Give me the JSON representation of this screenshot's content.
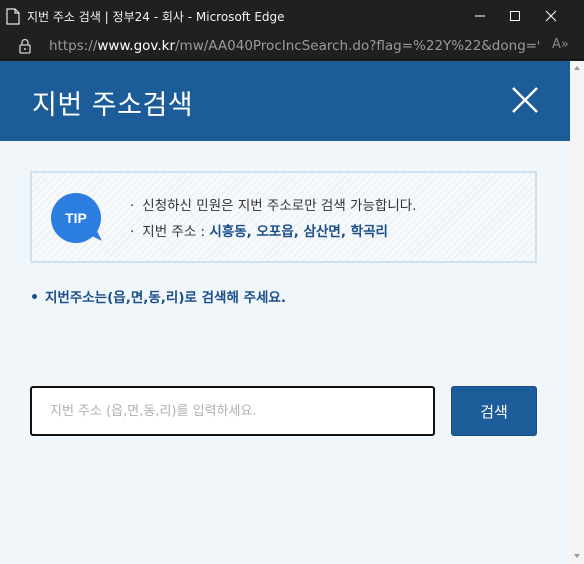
{
  "window": {
    "title": "지번 주소 검색 | 정부24 - 회사 - Microsoft Edge"
  },
  "address_bar": {
    "scheme": "https://",
    "host": "www.gov.kr",
    "path": "/mw/AA040ProcIncSearch.do?flag=%22Y%22&dong=%22...",
    "read_aloud_label": "A»"
  },
  "popup": {
    "title": "지번 주소검색",
    "tip": {
      "badge": "TIP",
      "line1": "신청하신 민원은 지번 주소로만 검색 가능합니다.",
      "line2_prefix": "지번 주소 : ",
      "line2_examples": "시흥동, 오포읍, 삼산면, 학곡리"
    },
    "instruction": "지번주소는(읍,면,동,리)로 검색해 주세요.",
    "search": {
      "value": "",
      "placeholder": "지번 주소 (읍,면,동,리)를 입력하세요.",
      "button_label": "검색"
    }
  },
  "colors": {
    "brand_blue": "#1b5c99",
    "tip_badge": "#2b7de0",
    "content_bg": "#f1f6fb"
  },
  "icons": {
    "tab": "document-icon",
    "lock": "lock-icon",
    "close": "close-icon"
  }
}
